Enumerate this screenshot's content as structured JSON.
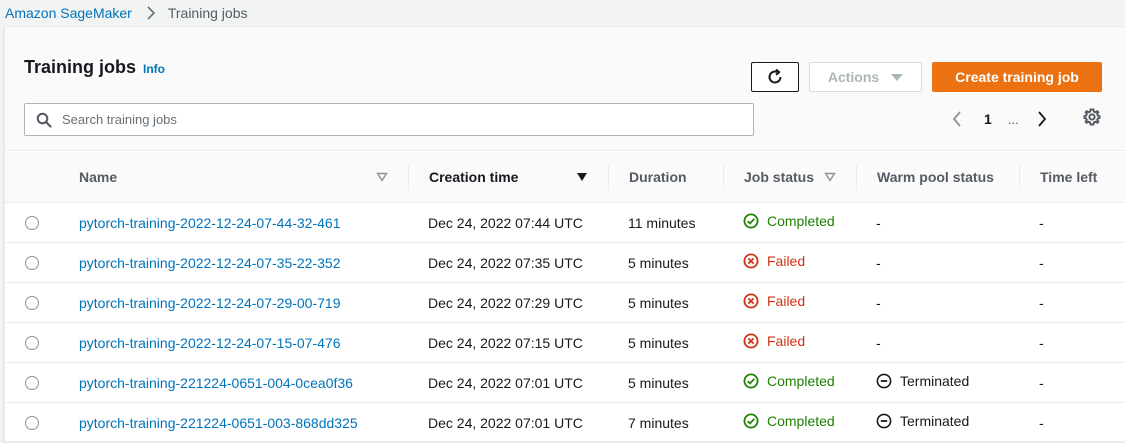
{
  "breadcrumb": {
    "root": "Amazon SageMaker",
    "current": "Training jobs"
  },
  "header": {
    "title": "Training jobs",
    "info": "Info",
    "actions_label": "Actions",
    "create_label": "Create training job"
  },
  "search": {
    "placeholder": "Search training jobs"
  },
  "pagination": {
    "current_page": "1",
    "ellipsis": "..."
  },
  "columns": {
    "name": "Name",
    "creation_time": "Creation time",
    "duration": "Duration",
    "job_status": "Job status",
    "warm_pool_status": "Warm pool status",
    "time_left": "Time left"
  },
  "colors": {
    "accent": "#ec7211",
    "link": "#0073bb",
    "success": "#1d8102",
    "error": "#d13212"
  },
  "rows": [
    {
      "name": "pytorch-training-2022-12-24-07-44-32-461",
      "creation_time": "Dec 24, 2022 07:44 UTC",
      "duration": "11 minutes",
      "status": "Completed",
      "warm_pool": "-",
      "time_left": "-"
    },
    {
      "name": "pytorch-training-2022-12-24-07-35-22-352",
      "creation_time": "Dec 24, 2022 07:35 UTC",
      "duration": "5 minutes",
      "status": "Failed",
      "warm_pool": "-",
      "time_left": "-"
    },
    {
      "name": "pytorch-training-2022-12-24-07-29-00-719",
      "creation_time": "Dec 24, 2022 07:29 UTC",
      "duration": "5 minutes",
      "status": "Failed",
      "warm_pool": "-",
      "time_left": "-"
    },
    {
      "name": "pytorch-training-2022-12-24-07-15-07-476",
      "creation_time": "Dec 24, 2022 07:15 UTC",
      "duration": "5 minutes",
      "status": "Failed",
      "warm_pool": "-",
      "time_left": "-"
    },
    {
      "name": "pytorch-training-221224-0651-004-0cea0f36",
      "creation_time": "Dec 24, 2022 07:01 UTC",
      "duration": "5 minutes",
      "status": "Completed",
      "warm_pool": "Terminated",
      "time_left": "-"
    },
    {
      "name": "pytorch-training-221224-0651-003-868dd325",
      "creation_time": "Dec 24, 2022 07:01 UTC",
      "duration": "7 minutes",
      "status": "Completed",
      "warm_pool": "Terminated",
      "time_left": "-"
    }
  ]
}
